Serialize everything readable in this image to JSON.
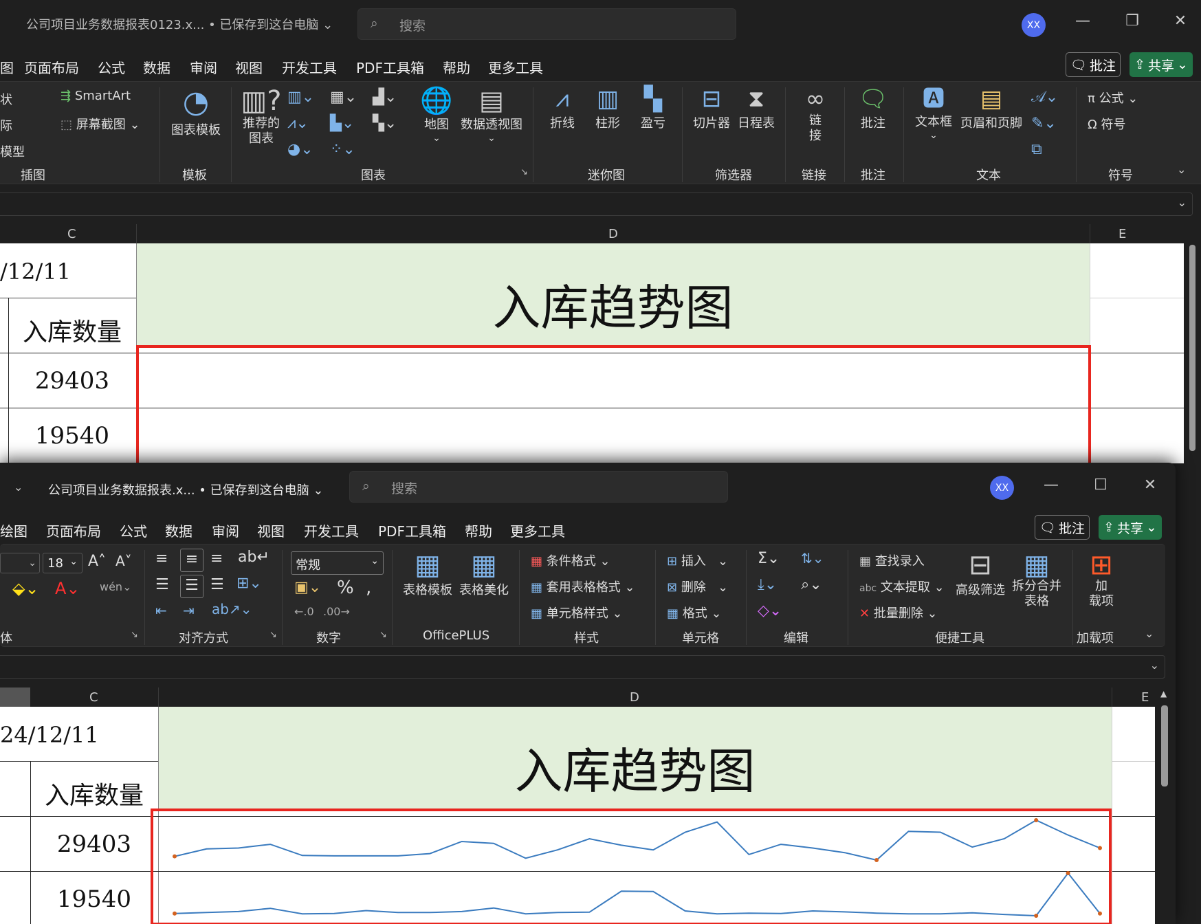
{
  "top": {
    "doc_title": "公司项目业务数据报表0123.x... • 已保存到这台电脑",
    "search_placeholder": "搜索",
    "avatar": "XX",
    "menu": [
      "图",
      "页面布局",
      "公式",
      "数据",
      "审阅",
      "视图",
      "开发工具",
      "PDF工具箱",
      "帮助",
      "更多工具"
    ],
    "comment_btn": "批注",
    "share_btn": "共享",
    "ribbon": {
      "insert_left": [
        "状",
        "际",
        "模型"
      ],
      "smartart": "SmartArt",
      "screenshot": "屏幕截图",
      "chart_template": "图表模板",
      "recommended_chart": "推荐的\n图表",
      "map": "地图",
      "pivot_chart": "数据透视图",
      "sparkline_line": "折线",
      "sparkline_column": "柱形",
      "sparkline_winloss": "盈亏",
      "slicer": "切片器",
      "timeline": "日程表",
      "link": "链\n接",
      "comment": "批注",
      "textbox": "文本框",
      "header_footer": "页眉和页脚",
      "equation": "公式",
      "symbol": "符号",
      "groups": [
        "插图",
        "模板",
        "图表",
        "迷你图",
        "筛选器",
        "链接",
        "批注",
        "文本",
        "符号"
      ]
    },
    "cols": [
      "C",
      "D",
      "E"
    ],
    "date": "/12/11",
    "header_cell": "入库数量",
    "title_cell": "入库趋势图",
    "values": [
      "29403",
      "19540"
    ]
  },
  "bottom": {
    "doc_title": "公司项目业务数据报表.x... • 已保存到这台电脑",
    "search_placeholder": "搜索",
    "avatar": "XX",
    "menu": [
      "绘图",
      "页面布局",
      "公式",
      "数据",
      "审阅",
      "视图",
      "开发工具",
      "PDF工具箱",
      "帮助",
      "更多工具"
    ],
    "comment_btn": "批注",
    "share_btn": "共享",
    "ribbon": {
      "font_size": "18",
      "number_format": "常规",
      "table_template": "表格模板",
      "table_beautify": "表格美化",
      "cond_format": "条件格式",
      "table_style": "套用表格格式",
      "cell_style": "单元格样式",
      "insert": "插入",
      "delete": "删除",
      "format": "格式",
      "find_enter": "查找录入",
      "text_extract": "文本提取",
      "batch_delete": "批量删除",
      "adv_filter": "高级筛选",
      "split_merge": "拆分合并\n表格",
      "addin": "加\n载项",
      "groups": [
        "体",
        "对齐方式",
        "数字",
        "OfficePLUS",
        "样式",
        "单元格",
        "编辑",
        "便捷工具",
        "加载项"
      ]
    },
    "cols": [
      "C",
      "D",
      "E"
    ],
    "date": "24/12/11",
    "header_cell": "入库数量",
    "title_cell": "入库趋势图",
    "values": [
      "29403",
      "19540"
    ]
  },
  "sparklines": {
    "row1": [
      29403,
      30200,
      30300,
      30700,
      29500,
      29450,
      29450,
      29450,
      29700,
      31000,
      30800,
      29200,
      30100,
      31300,
      30600,
      30100,
      32000,
      33100,
      29600,
      30700,
      30300,
      29800,
      29000,
      32100,
      32000,
      30400,
      31300,
      33300,
      31700,
      30300
    ],
    "row2": [
      19540,
      19700,
      19850,
      20350,
      19500,
      19540,
      20000,
      19700,
      19700,
      19850,
      20400,
      19500,
      19700,
      19750,
      23000,
      22950,
      19950,
      19500,
      19600,
      19540,
      19950,
      19800,
      19600,
      19500,
      19500,
      19650,
      19400,
      19200,
      25800,
      19540
    ],
    "line_color": "#3a7bbf",
    "marker_color": "#d4621f"
  }
}
